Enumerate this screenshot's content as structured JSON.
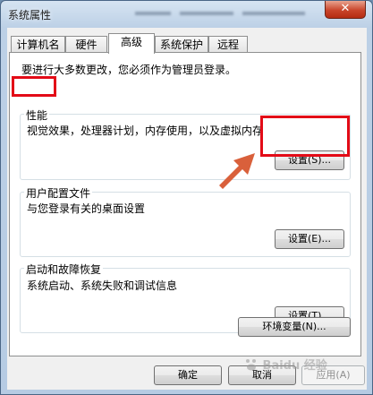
{
  "window": {
    "title": "系统属性",
    "close_symbol": "✕"
  },
  "tabs": [
    "计算机名",
    "硬件",
    "高级",
    "系统保护",
    "远程"
  ],
  "active_tab": "高级",
  "admin_note": "要进行大多数更改，您必须作为管理员登录。",
  "performance": {
    "label": "性能",
    "description": "视觉效果，处理器计划，内存使用，以及虚拟内存",
    "button": "设置(S)..."
  },
  "user_profiles": {
    "label": "用户配置文件",
    "description": "与您登录有关的桌面设置",
    "button": "设置(E)..."
  },
  "startup_recovery": {
    "label": "启动和故障恢复",
    "description": "系统启动、系统失败和调试信息",
    "button": "设置(T)..."
  },
  "env_button": "环境变量(N)...",
  "footer": {
    "ok": "确定",
    "cancel": "取消",
    "apply": "应用(A)"
  },
  "annotation_color": "#e30b17",
  "arrow_color": "#d9603b",
  "watermark": "Baidu 经验"
}
